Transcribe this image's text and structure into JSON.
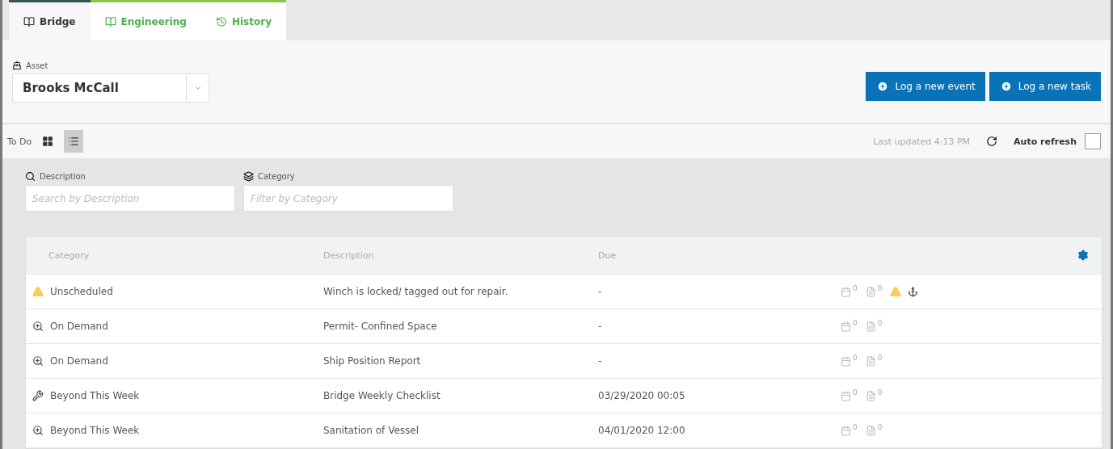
{
  "tabs": [
    {
      "label": "Bridge",
      "selected": true
    },
    {
      "label": "Engineering",
      "selected": false
    },
    {
      "label": "History",
      "selected": false
    }
  ],
  "asset": {
    "label": "Asset",
    "value": "Brooks McCall"
  },
  "actions": [
    "Log a new event",
    "Log a new task"
  ],
  "toolbar": {
    "title": "To Do",
    "views": [
      {
        "kind": "grid",
        "selected": false
      },
      {
        "kind": "list",
        "selected": true
      }
    ],
    "last_updated": "Last updated 4:13 PM",
    "auto_refresh": {
      "label": "Auto refresh",
      "checked": false
    }
  },
  "filters": [
    {
      "kind": "search",
      "label": "Description",
      "placeholder": "Search by Description"
    },
    {
      "kind": "category",
      "label": "Category",
      "placeholder": "Filter by Category"
    }
  ],
  "table": {
    "columns": [
      "Category",
      "Description",
      "Due"
    ],
    "rows": [
      {
        "kind": "unscheduled",
        "category": "Unscheduled",
        "description": "Winch is locked/ tagged out for repair.",
        "due": "-",
        "counts": [
          "0",
          "0"
        ],
        "alert": true
      },
      {
        "kind": "demand",
        "category": "On Demand",
        "description": "Permit- Confined Space",
        "due": "-",
        "counts": [
          "0",
          "0"
        ],
        "alert": false
      },
      {
        "kind": "demand",
        "category": "On Demand",
        "description": "Ship Position Report",
        "due": "-",
        "counts": [
          "0",
          "0"
        ],
        "alert": false
      },
      {
        "kind": "maintenance",
        "category": "Beyond This Week",
        "description": "Bridge Weekly Checklist",
        "due": "03/29/2020 00:05",
        "counts": [
          "0",
          "0"
        ],
        "alert": false
      },
      {
        "kind": "demand",
        "category": "Beyond This Week",
        "description": "Sanitation of Vessel",
        "due": "04/01/2020 12:00",
        "counts": [
          "0",
          "0"
        ],
        "alert": false
      }
    ]
  }
}
